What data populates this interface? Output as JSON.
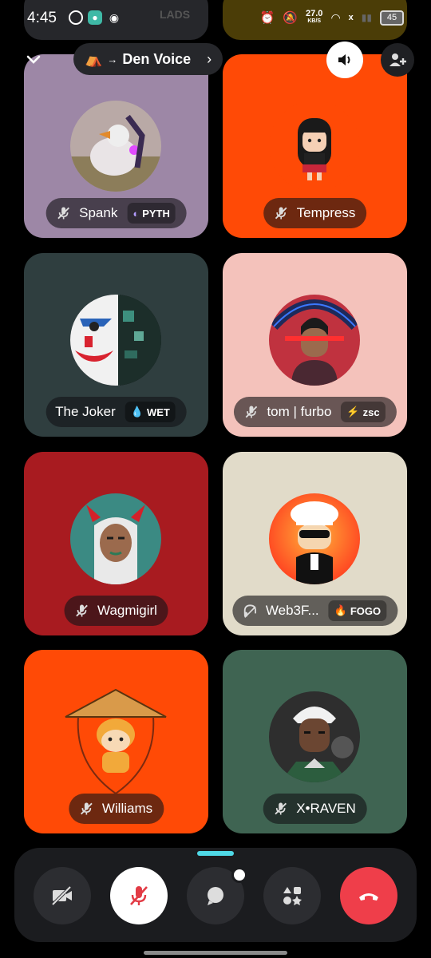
{
  "status_bar": {
    "time": "4:45",
    "speed_value": "27.0",
    "speed_unit": "KB/S",
    "battery": "45",
    "network_label": "x"
  },
  "header": {
    "channel_name": "Den Voice",
    "channel_icon": "tent-emoji"
  },
  "above_tiles": {
    "left_tag": "LADS"
  },
  "tiles": [
    {
      "name": "Spank",
      "tag": "PYTH",
      "tag_icon": "crescent",
      "bg": "#9d87a6",
      "muted": true
    },
    {
      "name": "Tempress",
      "tag": "",
      "bg": "#ff4a06",
      "muted": true
    },
    {
      "name": "The Joker",
      "tag": "WET",
      "tag_icon": "drop",
      "bg": "#2f3e3f",
      "muted": false
    },
    {
      "name": "tom | furbo",
      "tag": "zsc",
      "tag_icon": "bolt",
      "bg": "#f4c2bb",
      "muted": true
    },
    {
      "name": "Wagmigirl",
      "tag": "",
      "bg": "#a81b20",
      "muted": true
    },
    {
      "name": "Web3F...",
      "tag": "FOGO",
      "tag_icon": "fire",
      "bg": "#e1dbc9",
      "muted": false,
      "deafened": true
    },
    {
      "name": "Williams",
      "tag": "",
      "bg": "#ff4a06",
      "muted": true
    },
    {
      "name": "X•RAVEN",
      "tag": "",
      "bg": "#3f6452",
      "muted": true
    }
  ],
  "controls": {
    "accent_end_call": "#ef3e4a",
    "accent_drawer": "#4fd8e6"
  }
}
